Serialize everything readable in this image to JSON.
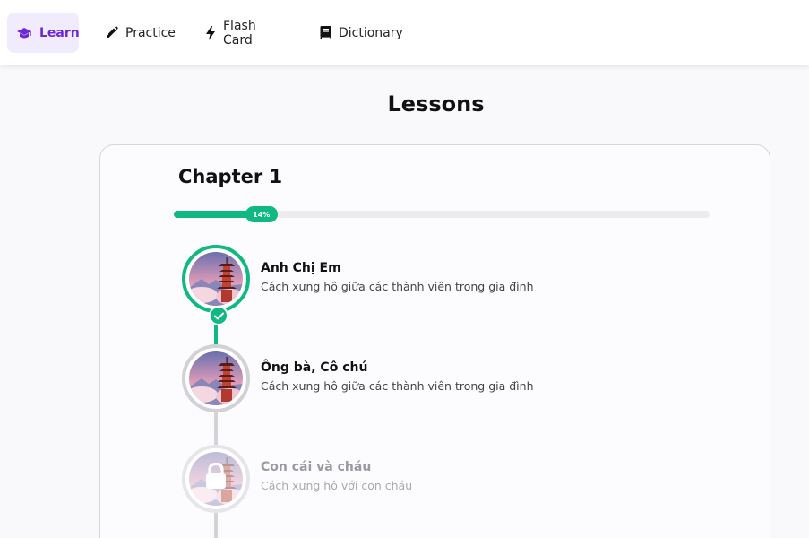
{
  "nav": {
    "items": [
      {
        "label": "Learn",
        "icon": "graduation-cap-icon",
        "active": true
      },
      {
        "label": "Practice",
        "icon": "pencil-icon",
        "active": false
      },
      {
        "label": "Flash Card",
        "icon": "lightning-bolt-icon",
        "active": false
      },
      {
        "label": "Dictionary",
        "icon": "book-icon",
        "active": false
      }
    ]
  },
  "page": {
    "title": "Lessons"
  },
  "chapter": {
    "title": "Chapter 1",
    "progress_label": "14%",
    "progress_fraction": 0.14
  },
  "lessons": [
    {
      "title": "Anh Chị Em",
      "subtitle": "Cách xưng hô giữa các thành viên trong gia đình",
      "status": "completed"
    },
    {
      "title": "Ông bà, Cô chú",
      "subtitle": "Cách xưng hô giữa các thành viên trong gia đình",
      "status": "unlocked"
    },
    {
      "title": "Con cái và cháu",
      "subtitle": "Cách xưng hô với con cháu",
      "status": "locked"
    }
  ],
  "colors": {
    "accent": "#6d28d9",
    "success": "#10b981",
    "track": "#ececee"
  }
}
